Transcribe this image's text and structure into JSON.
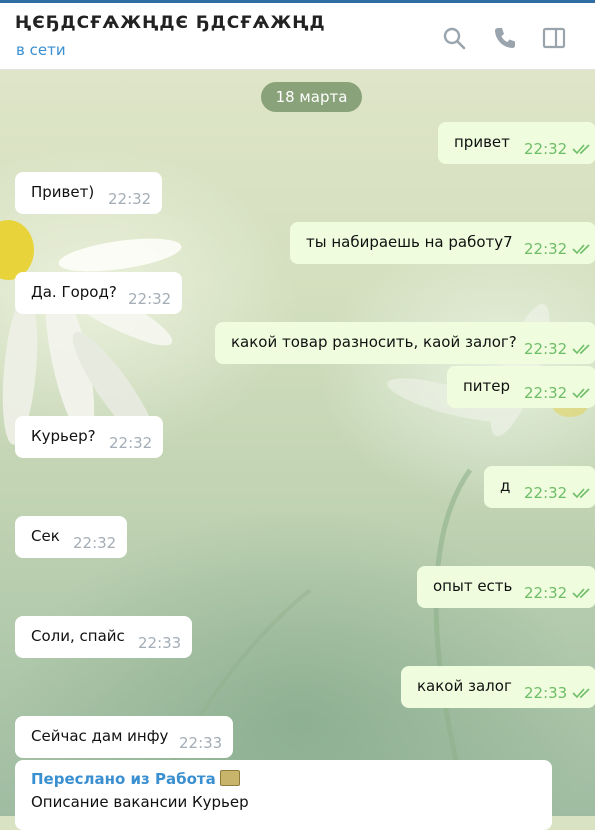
{
  "header": {
    "chat_name": "ҢЄҔДСҒѦЖҢДЄ ҔДСҒѦЖҢД",
    "status": "в сети",
    "icons": [
      "search-icon",
      "phone-icon",
      "sidebar-toggle-icon"
    ]
  },
  "colors": {
    "accent": "#3a8fd1",
    "outgoing_bubble": "#effdde",
    "incoming_bubble": "#ffffff",
    "read_check": "#6ebd68",
    "date_pill": "#6e8c5f"
  },
  "date_separator": "18 марта",
  "messages": [
    {
      "direction": "out",
      "text": "привет",
      "time": "22:32",
      "read": true
    },
    {
      "direction": "in",
      "text": "Привет)",
      "time": "22:32"
    },
    {
      "direction": "out",
      "text": "ты набираешь на работу7",
      "time": "22:32",
      "read": true
    },
    {
      "direction": "in",
      "text": "Да. Город?",
      "time": "22:32"
    },
    {
      "direction": "out",
      "text": "какой товар разносить, каой залог?",
      "time": "22:32",
      "read": true
    },
    {
      "direction": "out",
      "text": "питер",
      "time": "22:32",
      "read": true
    },
    {
      "direction": "in",
      "text": "Курьер?",
      "time": "22:32"
    },
    {
      "direction": "out",
      "text": "д",
      "time": "22:32",
      "read": true
    },
    {
      "direction": "in",
      "text": "Сек",
      "time": "22:32"
    },
    {
      "direction": "out",
      "text": "опыт есть",
      "time": "22:32",
      "read": true
    },
    {
      "direction": "in",
      "text": "Соли, спайс",
      "time": "22:33"
    },
    {
      "direction": "out",
      "text": "какой залог",
      "time": "22:33",
      "read": true
    },
    {
      "direction": "in",
      "text": "Сейчас дам инфу",
      "time": "22:33"
    }
  ],
  "forwarded": {
    "label": "Переслано из Работа",
    "emoji_icon": "money-bag-icon",
    "text": "Описание вакансии Курьер"
  }
}
